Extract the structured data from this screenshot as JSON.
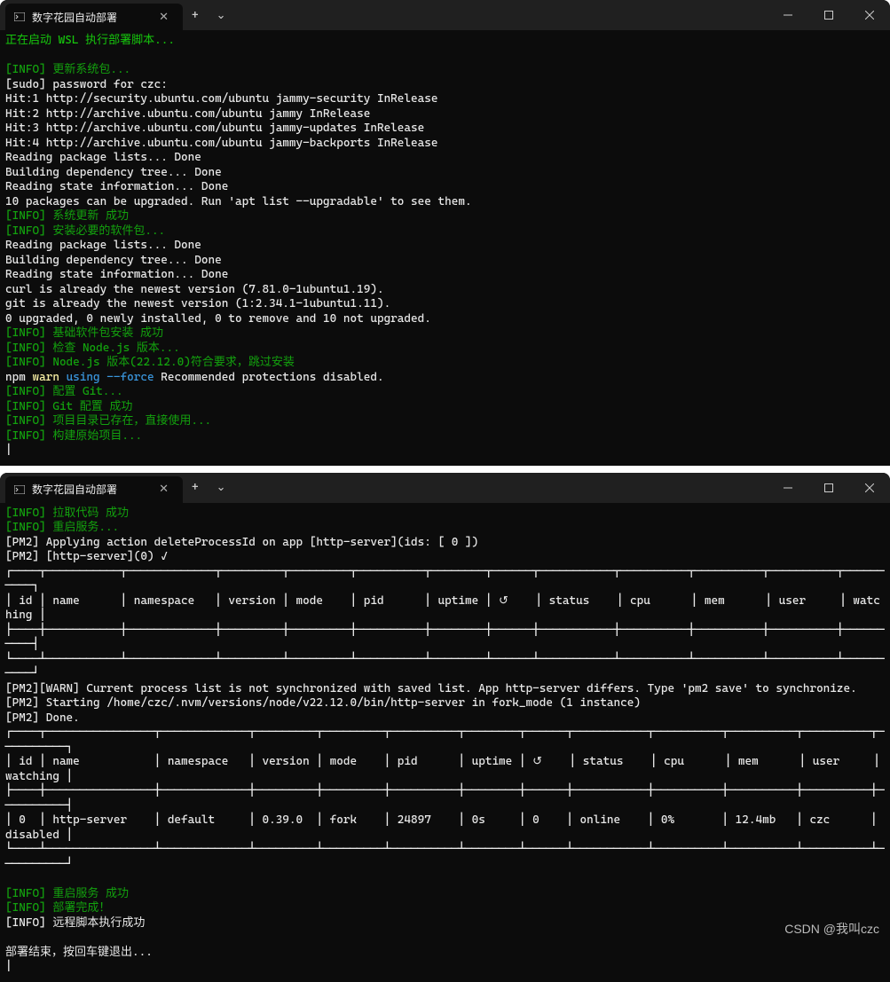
{
  "top": {
    "tab": {
      "title": "数字花园自动部署"
    },
    "controls": {
      "plus": "+",
      "chevron": "⌄",
      "min": "—",
      "max": "☐",
      "close": "✕"
    },
    "lines": [
      {
        "cls": "bgreen",
        "text": "正在启动 WSL 执行部署脚本..."
      },
      {
        "cls": "",
        "text": " "
      },
      {
        "cls": "green",
        "text": "[INFO] 更新系统包..."
      },
      {
        "cls": "white",
        "text": "[sudo] password for czc:"
      },
      {
        "cls": "white",
        "text": "Hit:1 http://security.ubuntu.com/ubuntu jammy-security InRelease"
      },
      {
        "cls": "white",
        "text": "Hit:2 http://archive.ubuntu.com/ubuntu jammy InRelease"
      },
      {
        "cls": "white",
        "text": "Hit:3 http://archive.ubuntu.com/ubuntu jammy-updates InRelease"
      },
      {
        "cls": "white",
        "text": "Hit:4 http://archive.ubuntu.com/ubuntu jammy-backports InRelease"
      },
      {
        "cls": "white",
        "text": "Reading package lists... Done"
      },
      {
        "cls": "white",
        "text": "Building dependency tree... Done"
      },
      {
        "cls": "white",
        "text": "Reading state information... Done"
      },
      {
        "cls": "white",
        "text": "10 packages can be upgraded. Run 'apt list --upgradable' to see them."
      },
      {
        "cls": "green",
        "text": "[INFO] 系统更新 成功"
      },
      {
        "cls": "green",
        "text": "[INFO] 安装必要的软件包..."
      },
      {
        "cls": "white",
        "text": "Reading package lists... Done"
      },
      {
        "cls": "white",
        "text": "Building dependency tree... Done"
      },
      {
        "cls": "white",
        "text": "Reading state information... Done"
      },
      {
        "cls": "white",
        "text": "curl is already the newest version (7.81.0-1ubuntu1.19)."
      },
      {
        "cls": "white",
        "text": "git is already the newest version (1:2.34.1-1ubuntu1.11)."
      },
      {
        "cls": "white",
        "text": "0 upgraded, 0 newly installed, 0 to remove and 10 not upgraded."
      },
      {
        "cls": "green",
        "text": "[INFO] 基础软件包安装 成功"
      },
      {
        "cls": "green",
        "text": "[INFO] 检查 Node.js 版本..."
      },
      {
        "cls": "green",
        "text": "[INFO] Node.js 版本(22.12.0)符合要求，跳过安装"
      },
      {
        "cls": "white",
        "spans": [
          {
            "cls": "white",
            "text": "npm "
          },
          {
            "cls": "byellow",
            "text": "warn "
          },
          {
            "cls": "cyan",
            "text": "using --force"
          },
          {
            "cls": "white",
            "text": " Recommended protections disabled."
          }
        ]
      },
      {
        "cls": "green",
        "text": "[INFO] 配置 Git..."
      },
      {
        "cls": "green",
        "text": "[INFO] Git 配置 成功"
      },
      {
        "cls": "green",
        "text": "[INFO] 项目目录已存在，直接使用..."
      },
      {
        "cls": "green",
        "text": "[INFO] 构建原始项目..."
      },
      {
        "cls": "white",
        "text": "|"
      }
    ]
  },
  "bottom": {
    "tab": {
      "title": "数字花园自动部署"
    },
    "lines": [
      {
        "cls": "green",
        "text": "[INFO] 拉取代码 成功"
      },
      {
        "cls": "green",
        "text": "[INFO] 重启服务..."
      },
      {
        "cls": "white",
        "text": "[PM2] Applying action deleteProcessId on app [http-server](ids: [ 0 ])"
      },
      {
        "cls": "white",
        "text": "[PM2] [http-server](0) ✓"
      },
      {
        "cls": "white",
        "text": "┌────┬───────────┬─────────────┬─────────┬─────────┬──────────┬────────┬──────┬───────────┬──────────┬──────────┬──────────┬──────────┐"
      },
      {
        "cls": "white",
        "text": "│ id │ name      │ namespace   │ version │ mode    │ pid      │ uptime │ ↺    │ status    │ cpu      │ mem      │ user     │ watching │"
      },
      {
        "cls": "white",
        "text": "├────┼───────────┼─────────────┼─────────┼─────────┼──────────┼────────┼──────┼───────────┼──────────┼──────────┼──────────┼──────────┤"
      },
      {
        "cls": "white",
        "text": "└────┴───────────┴─────────────┴─────────┴─────────┴──────────┴────────┴──────┴───────────┴──────────┴──────────┴──────────┴──────────┘"
      },
      {
        "cls": "white",
        "text": "[PM2][WARN] Current process list is not synchronized with saved list. App http-server differs. Type 'pm2 save' to synchronize."
      },
      {
        "cls": "white",
        "text": "[PM2] Starting /home/czc/.nvm/versions/node/v22.12.0/bin/http-server in fork_mode (1 instance)"
      },
      {
        "cls": "white",
        "text": "[PM2] Done."
      },
      {
        "cls": "white",
        "text": "┌────┬────────────────┬─────────────┬─────────┬─────────┬──────────┬────────┬──────┬───────────┬──────────┬──────────┬──────────┬──────────┐"
      },
      {
        "cls": "white",
        "text": "│ id │ name           │ namespace   │ version │ mode    │ pid      │ uptime │ ↺    │ status    │ cpu      │ mem      │ user     │ watching │"
      },
      {
        "cls": "white",
        "text": "├────┼────────────────┼─────────────┼─────────┼─────────┼──────────┼────────┼──────┼───────────┼──────────┼──────────┼──────────┼──────────┤"
      },
      {
        "cls": "white",
        "text": "│ 0  │ http-server    │ default     │ 0.39.0  │ fork    │ 24897    │ 0s     │ 0    │ online    │ 0%       │ 12.4mb   │ czc      │ disabled │"
      },
      {
        "cls": "white",
        "text": "└────┴────────────────┴─────────────┴─────────┴─────────┴──────────┴────────┴──────┴───────────┴──────────┴──────────┴──────────┴──────────┘"
      },
      {
        "cls": "",
        "text": " "
      },
      {
        "cls": "green",
        "text": "[INFO] 重启服务 成功"
      },
      {
        "cls": "green",
        "text": "[INFO] 部署完成！"
      },
      {
        "cls": "white",
        "text": "[INFO] 远程脚本执行成功"
      },
      {
        "cls": "",
        "text": " "
      },
      {
        "cls": "white",
        "text": "部署结束，按回车键退出..."
      },
      {
        "cls": "white",
        "text": "|"
      }
    ]
  },
  "watermark": "CSDN @我叫czc"
}
